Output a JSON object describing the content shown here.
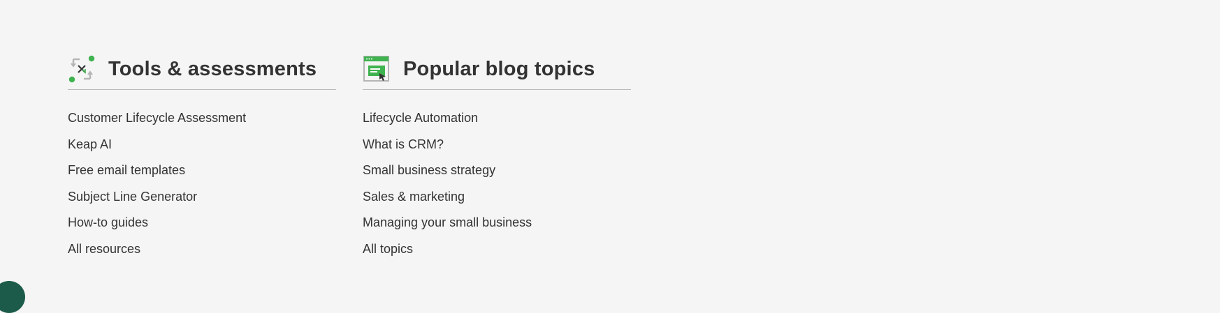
{
  "colors": {
    "background": "#f5f5f5",
    "text": "#333333",
    "accent_green": "#3fb34f",
    "divider": "#b9b9b9"
  },
  "tools": {
    "icon": "process-arrows-icon",
    "heading": "Tools & assessments",
    "links": [
      {
        "label": "Customer Lifecycle Assessment"
      },
      {
        "label": "Keap AI"
      },
      {
        "label": "Free email templates"
      },
      {
        "label": "Subject Line Generator"
      },
      {
        "label": "How-to guides"
      },
      {
        "label": "All resources"
      }
    ]
  },
  "blog": {
    "icon": "browser-window-icon",
    "heading": "Popular blog topics",
    "links": [
      {
        "label": "Lifecycle Automation"
      },
      {
        "label": "What is CRM?"
      },
      {
        "label": "Small business strategy"
      },
      {
        "label": "Sales & marketing"
      },
      {
        "label": "Managing your small business"
      },
      {
        "label": "All topics"
      }
    ]
  }
}
